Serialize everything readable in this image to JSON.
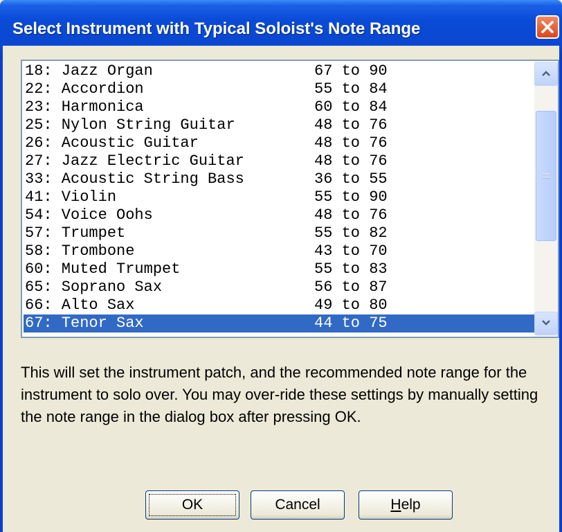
{
  "window": {
    "title": "Select Instrument with Typical Soloist's Note Range"
  },
  "list": {
    "items": [
      {
        "name": "18: Jazz Organ",
        "range": "67 to 90"
      },
      {
        "name": "22: Accordion",
        "range": "55 to 84"
      },
      {
        "name": "23: Harmonica",
        "range": "60 to 84"
      },
      {
        "name": "25: Nylon String Guitar",
        "range": "48 to 76"
      },
      {
        "name": "26: Acoustic Guitar",
        "range": "48 to 76"
      },
      {
        "name": "27: Jazz Electric Guitar",
        "range": "48 to 76"
      },
      {
        "name": "33: Acoustic String Bass",
        "range": "36 to 55"
      },
      {
        "name": "41: Violin",
        "range": "55 to 90"
      },
      {
        "name": "54: Voice Oohs",
        "range": "48 to 76"
      },
      {
        "name": "57: Trumpet",
        "range": "55 to 82"
      },
      {
        "name": "58: Trombone",
        "range": "43 to 70"
      },
      {
        "name": "60: Muted Trumpet",
        "range": "55 to 83"
      },
      {
        "name": "65: Soprano Sax",
        "range": "56 to 87"
      },
      {
        "name": "66: Alto Sax",
        "range": "49 to 80"
      },
      {
        "name": "67: Tenor Sax",
        "range": "44 to 75",
        "selected": true
      }
    ]
  },
  "description": "This will set the instrument patch, and the recommended note range for the instrument to solo over. You may over-ride these settings by manually setting the note range in the dialog box after pressing OK.",
  "buttons": {
    "ok": "OK",
    "cancel": "Cancel",
    "help_accel": "H",
    "help_rest": "elp"
  },
  "colors": {
    "selection": "#316ac5",
    "titlebar": "#0a47d0",
    "close": "#d9461e"
  },
  "icons": {
    "close": "close-x-icon",
    "scroll_up": "arrow-up-icon",
    "scroll_down": "arrow-down-icon"
  }
}
